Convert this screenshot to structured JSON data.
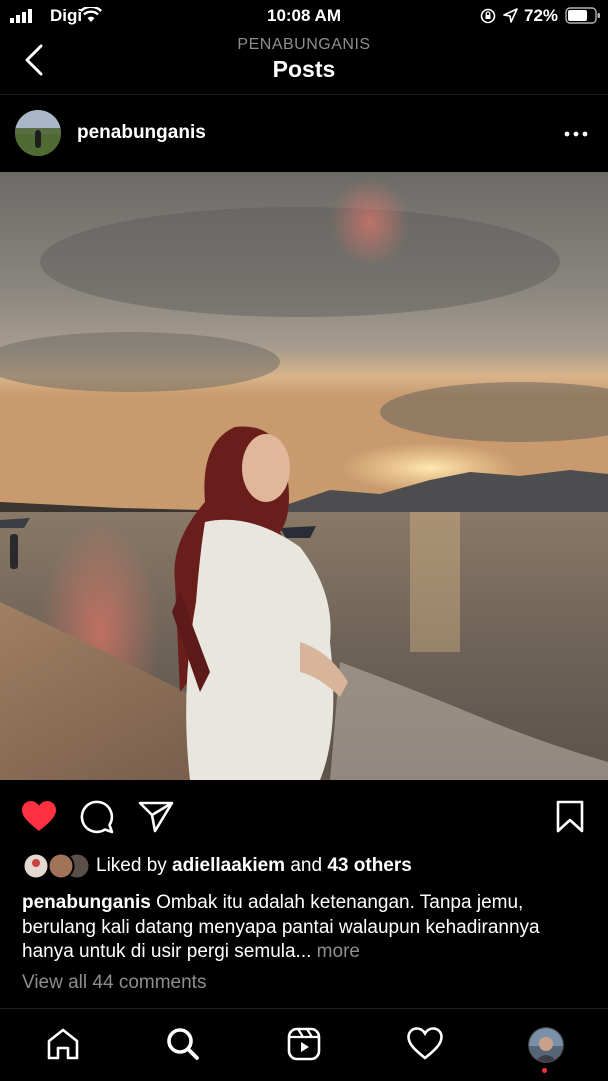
{
  "status_bar": {
    "carrier": "Digi",
    "time": "10:08 AM",
    "battery_pct": "72%"
  },
  "header": {
    "account": "PENABUNGANIS",
    "title": "Posts"
  },
  "post": {
    "username": "penabunganis",
    "liked_by_prefix": "Liked by ",
    "liked_by_user": "adiellaakiem",
    "liked_by_and": " and ",
    "liked_by_others": "43 others",
    "caption_user": "penabunganis",
    "caption_text": " Ombak itu adalah ketenangan. Tanpa jemu, berulang kali datang menyapa pantai walaupun kehadirannya hanya untuk di usir pergi semula... ",
    "caption_more": "more",
    "view_comments": "View all 44 comments",
    "liked": true
  },
  "colors": {
    "like_red": "#ff3040",
    "muted": "#8e8e8e"
  },
  "icons": [
    "back-icon",
    "more-icon",
    "heart-icon",
    "comment-icon",
    "share-icon",
    "bookmark-icon",
    "home-icon",
    "search-icon",
    "reels-icon",
    "activity-icon"
  ]
}
